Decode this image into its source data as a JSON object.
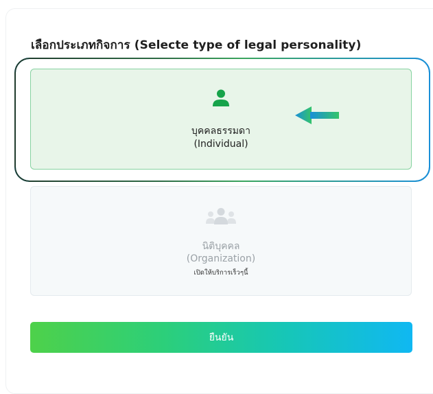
{
  "page": {
    "title": "เลือกประเภทกิจการ (Selecte type of legal personality)"
  },
  "options": [
    {
      "label_th": "บุคคลธรรมดา",
      "label_en": "(Individual)",
      "icon": "person-icon",
      "selected": true,
      "enabled": true
    },
    {
      "label_th": "นิติบุคคล",
      "label_en": "(Organization)",
      "note": "เปิดให้บริการเร็วๆนี้",
      "icon": "group-icon",
      "selected": false,
      "enabled": false
    }
  ],
  "confirm_button": {
    "label": "ยืนยัน"
  },
  "colors": {
    "accent_green": "#16a34a",
    "selected_bg": "#e8f5e9",
    "highlight_blue": "#1a8fd8",
    "button_gradient_start": "#4ed14a",
    "button_gradient_end": "#10b8f2"
  }
}
